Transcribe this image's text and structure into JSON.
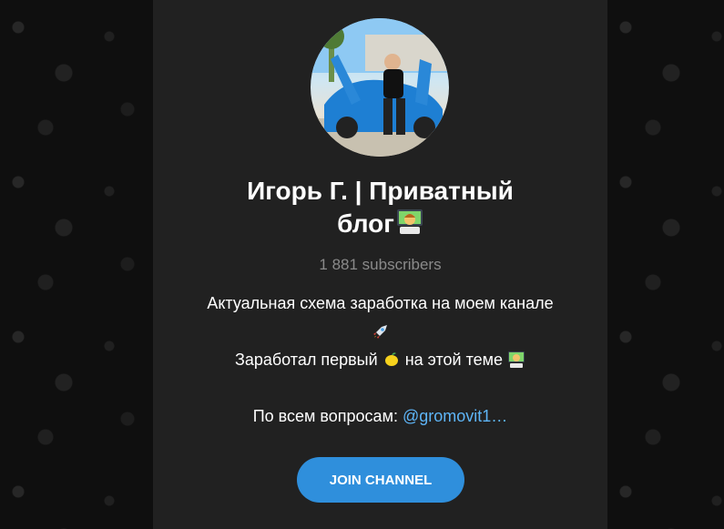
{
  "channel": {
    "title_line1": "Игорь Г. | Приватный",
    "title_line2": "блог",
    "subscribers": "1 881 subscribers",
    "description": {
      "line1": "Актуальная схема заработка на моем канале",
      "line3_a": "Заработал первый",
      "line3_b": "на этой теме",
      "line5_prefix": "По всем вопросам:",
      "line5_mention": "@gromovit1…"
    },
    "join_label": "JOIN CHANNEL"
  },
  "icons": [
    "technologist-emoji-icon",
    "rocket-icon",
    "lemon-icon",
    "technologist-emoji-icon"
  ],
  "colors": {
    "accent": "#2f8fdc",
    "link": "#5eb5f7",
    "panel": "#212121"
  }
}
